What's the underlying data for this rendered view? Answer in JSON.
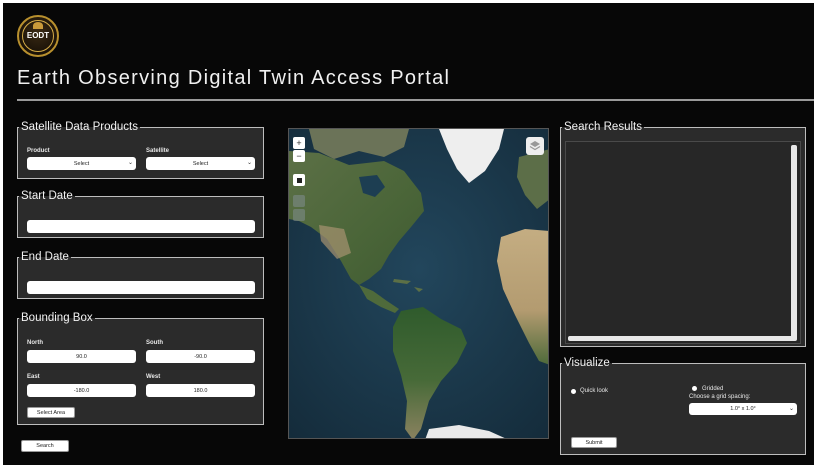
{
  "header": {
    "logo_text": "EODT",
    "title": "Earth Observing Digital Twin Access Portal"
  },
  "satellite_panel": {
    "legend": "Satellite Data Products",
    "product_label": "Product",
    "product_value": "Select",
    "satellite_label": "Satellite",
    "satellite_value": "Select"
  },
  "start_date": {
    "legend": "Start Date",
    "value": ""
  },
  "end_date": {
    "legend": "End Date",
    "value": ""
  },
  "bounding_box": {
    "legend": "Bounding Box",
    "north_label": "North",
    "north_value": "90.0",
    "south_label": "South",
    "south_value": "-90.0",
    "east_label": "East",
    "east_value": "-180.0",
    "west_label": "West",
    "west_value": "180.0",
    "select_area_label": "Select Area"
  },
  "search_button": "Search",
  "map": {
    "zoom_in": "+",
    "zoom_out": "−",
    "colors": {
      "ocean": "#1c3a4e",
      "land": "#4f6a3b",
      "desert": "#b8a27a",
      "ice": "#f1f1f1"
    }
  },
  "search_results": {
    "legend": "Search Results"
  },
  "visualize": {
    "legend": "Visualize",
    "quick_look_label": "Quick look",
    "gridded_label": "Gridded",
    "grid_prompt": "Choose a grid spacing:",
    "grid_value": "1.0° x 1.0°",
    "submit_label": "Submit"
  }
}
